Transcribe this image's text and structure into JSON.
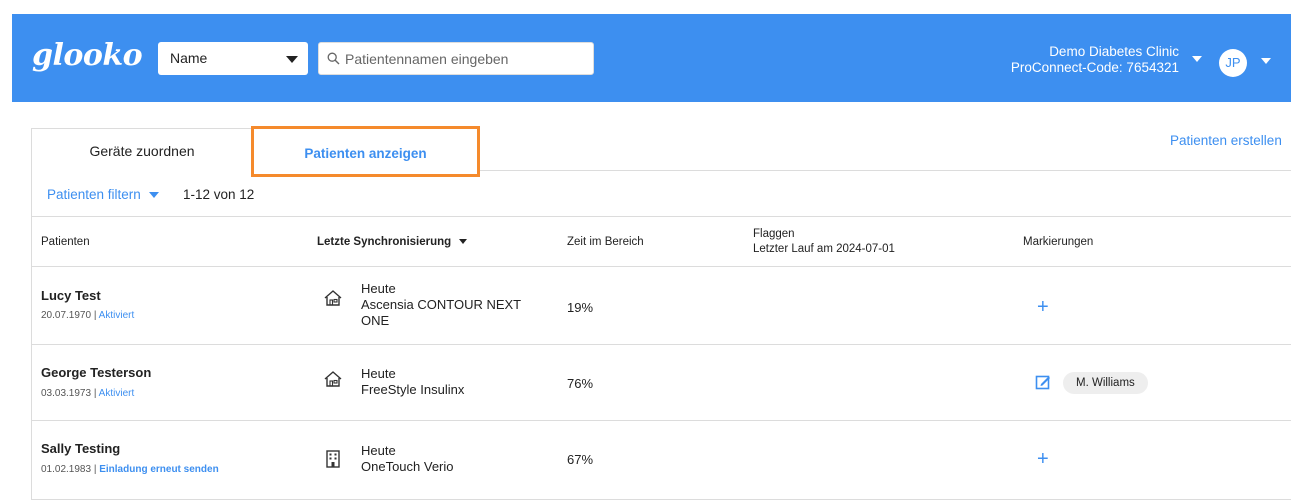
{
  "header": {
    "logo": "glooko",
    "select_value": "Name",
    "search_placeholder": "Patientennamen eingeben",
    "clinic_name": "Demo Diabetes Clinic",
    "proconnect": "ProConnect-Code: 7654321",
    "avatar_initials": "JP",
    "colors": {
      "bar": "#3d8ff0",
      "highlight": "#f58a2c"
    }
  },
  "actions": {
    "create_patients": "Patienten erstellen"
  },
  "tabs": [
    {
      "label": "Geräte zuordnen",
      "active": false
    },
    {
      "label": "Patienten anzeigen",
      "active": true
    }
  ],
  "filter": {
    "label": "Patienten filtern",
    "count": "1-12 von 12"
  },
  "table": {
    "headers": {
      "patients": "Patienten",
      "last_sync": "Letzte Synchronisierung",
      "time_in_range": "Zeit im Bereich",
      "flags": "Flaggen",
      "flags_sub": "Letzter Lauf am 2024-07-01",
      "tags": "Markierungen"
    },
    "rows": [
      {
        "name": "Lucy Test",
        "dob": "20.07.1970",
        "status": "Aktiviert",
        "sync_when": "Heute",
        "device": "Ascensia CONTOUR NEXT ONE",
        "device_icon": "home-icon",
        "tir": "19%",
        "tag": null
      },
      {
        "name": "George Testerson",
        "dob": "03.03.1973",
        "status": "Aktiviert",
        "sync_when": "Heute",
        "device": "FreeStyle Insulinx",
        "device_icon": "home-icon",
        "tir": "76%",
        "tag": "M. Williams"
      },
      {
        "name": "Sally Testing",
        "dob": "01.02.1983",
        "status": "Einladung erneut senden",
        "sync_when": "Heute",
        "device": "OneTouch Verio",
        "device_icon": "clinic-building-icon",
        "tir": "67%",
        "tag": null
      }
    ]
  },
  "icons": {
    "search": "search-icon",
    "add": "plus-icon",
    "edit": "edit-icon"
  }
}
